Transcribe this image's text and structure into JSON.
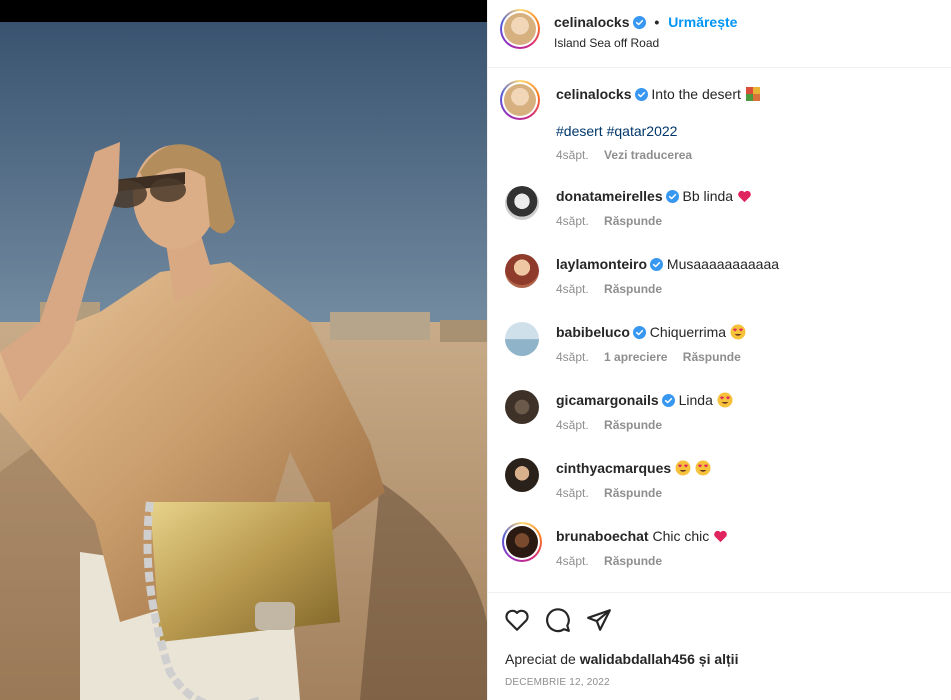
{
  "header": {
    "username": "celinalocks",
    "separator": "•",
    "follow_label": "Urmărește",
    "location": "Island Sea off Road"
  },
  "caption": {
    "username": "celinalocks",
    "text": "Into the desert",
    "hashtags": "#desert #qatar2022",
    "time": "4săpt.",
    "translate_label": "Vezi traducerea"
  },
  "comments": [
    {
      "username": "donatameirelles",
      "text": "Bb linda",
      "emoji": "heart",
      "time": "4săpt.",
      "reply_label": "Răspunde",
      "likes": ""
    },
    {
      "username": "laylamonteiro",
      "text": "Musaaaaaaaaaaa",
      "emoji": "",
      "time": "4săpt.",
      "reply_label": "Răspunde",
      "likes": ""
    },
    {
      "username": "babibeluco",
      "text": "Chiquerrima",
      "emoji": "heart-eyes",
      "time": "4săpt.",
      "reply_label": "Răspunde",
      "likes": "1 apreciere"
    },
    {
      "username": "gicamargonails",
      "text": "Linda",
      "emoji": "heart-eyes",
      "time": "4săpt.",
      "reply_label": "Răspunde",
      "likes": ""
    },
    {
      "username": "cinthyacmarques",
      "text": "",
      "emoji": "heart-eyes-x2",
      "time": "4săpt.",
      "reply_label": "Răspunde",
      "likes": ""
    },
    {
      "username": "brunaboechat",
      "text": "Chic chic",
      "emoji": "heart",
      "time": "4săpt.",
      "reply_label": "Răspunde",
      "likes": ""
    }
  ],
  "footer": {
    "liked_prefix": "Apreciat de",
    "liked_user": "walidabdallah456",
    "liked_suffix": "și alții",
    "date": "DECEMBRIE 12, 2022"
  },
  "colors": {
    "accent": "#0095f6",
    "verified": "#3897f0",
    "hashtag": "#00376b",
    "muted": "#8e8e8e"
  },
  "icons": [
    "verified-badge-icon",
    "heart-icon",
    "comment-icon",
    "share-icon"
  ]
}
